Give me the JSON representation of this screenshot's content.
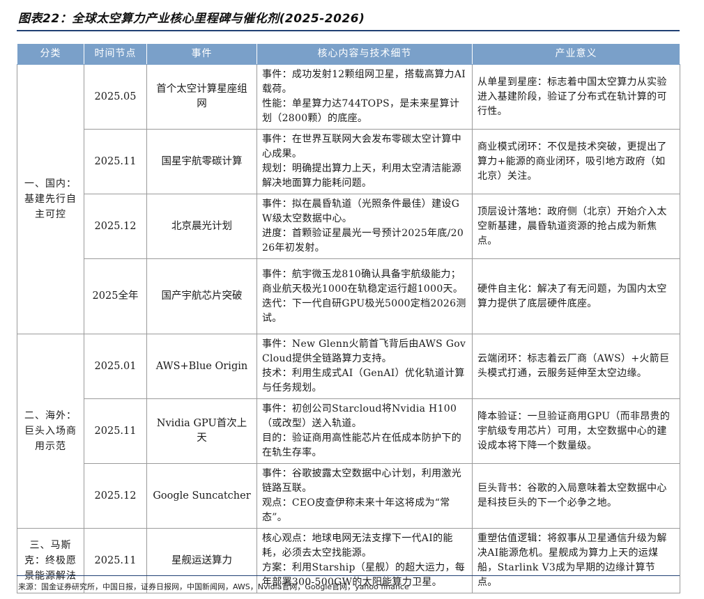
{
  "title": "图表22：全球太空算力产业核心里程碑与催化剂(2025-2026)",
  "table": {
    "headers": [
      "分类",
      "时间节点",
      "事件",
      "核心内容与技术细节",
      "产业意义"
    ],
    "groups": [
      {
        "category": "一、国内：基建先行自主可控",
        "rows": [
          {
            "time": "2025.05",
            "event": "首个太空计算星座组网",
            "content": [
              "事件：成功发射12颗组网卫星，搭载高算力AI载荷。",
              "性能：单星算力达744TOPS，是未来星算计划（2800颗）的底座。"
            ],
            "significance": "从单星到星座：标志着中国太空算力从实验进入基建阶段，验证了分布式在轨计算的可行性。"
          },
          {
            "time": "2025.11",
            "event": "国星宇航零碳计算",
            "content": [
              "事件：在世界互联网大会发布零碳太空计算中心成果。",
              "规划：明确提出算力上天，利用太空清洁能源解决地面算力能耗问题。"
            ],
            "significance": "商业模式闭环：不仅是技术突破，更提出了算力+能源的商业闭环，吸引地方政府（如北京）关注。"
          },
          {
            "time": "2025.12",
            "event": "北京晨光计划",
            "content": [
              "事件：拟在晨昏轨道（光照条件最佳）建设GW级太空数据中心。",
              "进度：首颗验证星晨光一号预计2025年底/2026年初发射。"
            ],
            "significance": "顶层设计落地：政府侧（北京）开始介入太空新基建，晨昏轨道资源的抢占成为新焦点。"
          },
          {
            "time": "2025全年",
            "event": "国产宇航芯片突破",
            "content": [
              "事件：航宇微玉龙810确认具备宇航级能力；商业航天极光1000在轨稳定运行超1000天。",
              "迭代：下一代自研GPU极光5000定档2026测试。"
            ],
            "significance": "硬件自主化：解决了有无问题，为国内太空算力提供了底层硬件底座。"
          }
        ]
      },
      {
        "category": "二、海外：巨头入场商用示范",
        "rows": [
          {
            "time": "2025.01",
            "event": "AWS+Blue Origin",
            "content": [
              "事件：New Glenn火箭首飞背后由AWS Gov Cloud提供全链路算力支持。",
              "技术：利用生成式AI（GenAI）优化轨道计算与任务规划。"
            ],
            "significance": "云端闭环：标志着云厂商（AWS）+火箭巨头模式打通，云服务延伸至太空边缘。"
          },
          {
            "time": "2025.11",
            "event": "Nvidia GPU首次上天",
            "content": [
              "事件：初创公司Starcloud将Nvidia H100（或改型）送入轨道。",
              "目的：验证商用高性能芯片在低成本防护下的在轨生存率。"
            ],
            "significance": "降本验证：一旦验证商用GPU（而非昂贵的宇航级专用芯片）可用，太空数据中心的建设成本将下降一个数量级。"
          },
          {
            "time": "2025.12",
            "event": "Google Suncatcher",
            "content": [
              "事件：谷歌披露太空数据中心计划，利用激光链路互联。",
              "观点：CEO皮查伊称未来十年这将成为“常态”。"
            ],
            "significance": "巨头背书：谷歌的入局意味着太空数据中心是科技巨头的下一个必争之地。"
          }
        ]
      },
      {
        "category": "三、马斯克：终极愿景能源解法",
        "rows": [
          {
            "time": "2025.11",
            "event": "星舰运送算力",
            "content": [
              "核心观点：地球电网无法支撑下一代AI的能耗，必须去太空找能源。",
              "方案：利用Starship（星舰）的超大运力，每年部署300-500GW的太阳能算力卫星。"
            ],
            "significance": "重塑估值逻辑：将叙事从卫星通信升级为解决AI能源危机。星舰成为算力上天的运煤船，Starlink V3成为早期的边缘计算节点。"
          }
        ]
      }
    ]
  },
  "source": "来源：国金证券研究所，中国日报，证券日报网，中国新闻网，AWS，Nvidia官网，Google官网，yahoo finance"
}
